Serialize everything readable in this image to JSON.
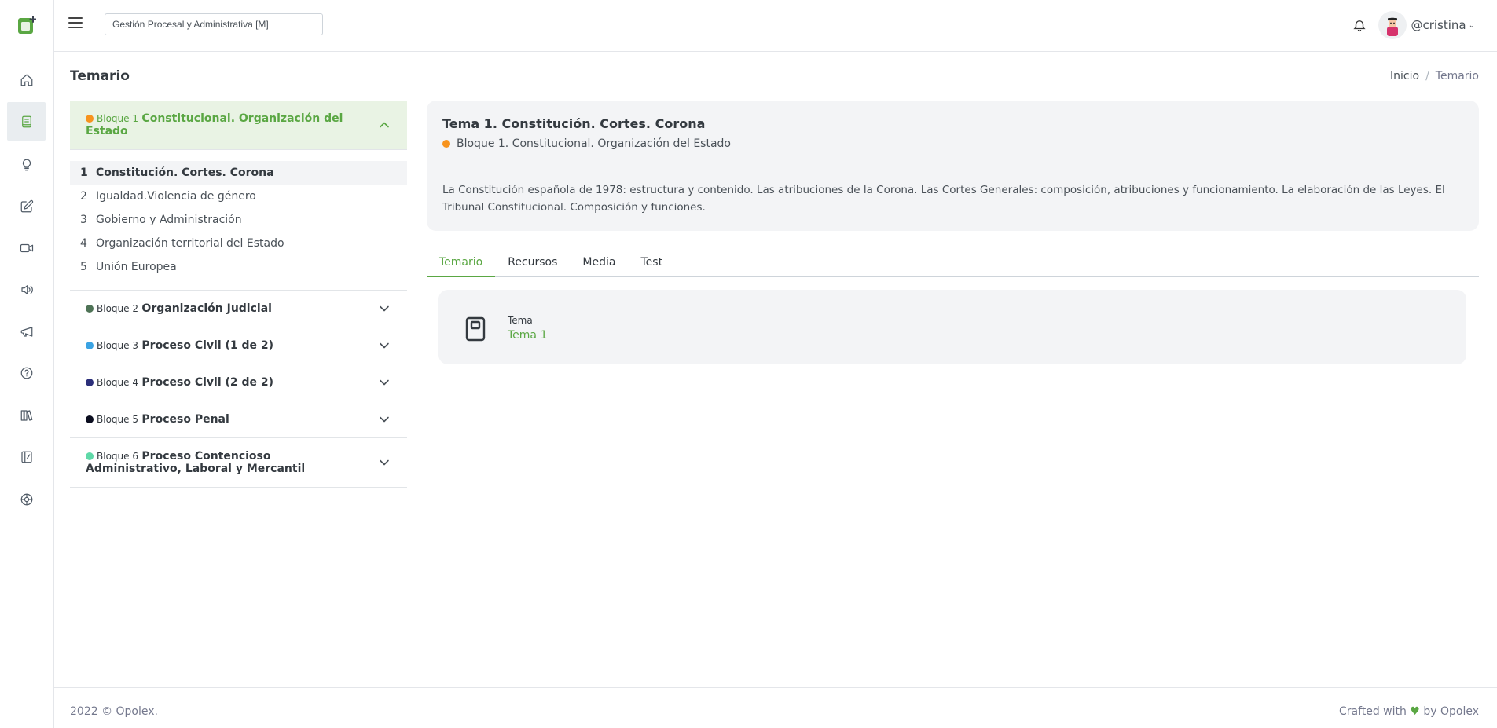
{
  "app": {
    "logo_icon": "app-logo-icon",
    "accent_color": "#5aa743"
  },
  "rail": {
    "items": [
      {
        "icon": "home-icon",
        "active": false
      },
      {
        "icon": "book-icon",
        "active": true
      },
      {
        "icon": "lightbulb-icon",
        "active": false
      },
      {
        "icon": "edit-icon",
        "active": false
      },
      {
        "icon": "video-icon",
        "active": false
      },
      {
        "icon": "audio-icon",
        "active": false
      },
      {
        "icon": "megaphone-icon",
        "active": false
      },
      {
        "icon": "help-icon",
        "active": false
      },
      {
        "icon": "library-icon",
        "active": false
      },
      {
        "icon": "notebook-icon",
        "active": false
      },
      {
        "icon": "support-icon",
        "active": false
      }
    ]
  },
  "header": {
    "course_select_value": "Gestión Procesal y Administrativa [M]",
    "username": "@cristina"
  },
  "page": {
    "title": "Temario",
    "breadcrumb": {
      "home": "Inicio",
      "sep": "/",
      "current": "Temario"
    }
  },
  "accordion": {
    "block1": {
      "prefix": "Bloque 1",
      "name": "Constitucional. Organización del Estado",
      "color": "#f7931e",
      "topics": [
        {
          "num": "1",
          "label": "Constitución. Cortes. Corona"
        },
        {
          "num": "2",
          "label": "Igualdad.Violencia de género"
        },
        {
          "num": "3",
          "label": "Gobierno y Administración"
        },
        {
          "num": "4",
          "label": "Organización territorial del Estado"
        },
        {
          "num": "5",
          "label": "Unión Europea"
        }
      ]
    },
    "block2": {
      "prefix": "Bloque 2",
      "name": "Organización Judicial",
      "color": "#4e7356"
    },
    "block3": {
      "prefix": "Bloque 3",
      "name": "Proceso Civil (1 de 2)",
      "color": "#3ba3e3"
    },
    "block4": {
      "prefix": "Bloque 4",
      "name": "Proceso Civil (2 de 2)",
      "color": "#2c2f7a"
    },
    "block5": {
      "prefix": "Bloque 5",
      "name": "Proceso Penal",
      "color": "#0b0d1f"
    },
    "block6": {
      "prefix": "Bloque 6",
      "name": "Proceso Contencioso Administrativo, Laboral y Mercantil",
      "color": "#5fd9a8"
    }
  },
  "detail": {
    "title": "Tema 1. Constitución. Cortes. Corona",
    "block_label": "Bloque 1. Constitucional. Organización del Estado",
    "description": "La Constitución española de 1978: estructura y contenido. Las atribuciones de la Corona. Las Cortes Generales: composición, atribuciones y funcionamiento. La elaboración de las Leyes. El Tribunal Constitucional. Composición y funciones."
  },
  "tabs": [
    {
      "label": "Temario",
      "active": true
    },
    {
      "label": "Recursos",
      "active": false
    },
    {
      "label": "Media",
      "active": false
    },
    {
      "label": "Test",
      "active": false
    }
  ],
  "resource": {
    "label": "Tema",
    "value": "Tema 1"
  },
  "footer": {
    "left": "2022 © Opolex.",
    "right_pre": "Crafted with",
    "heart": "♥",
    "right_post": "by Opolex"
  }
}
